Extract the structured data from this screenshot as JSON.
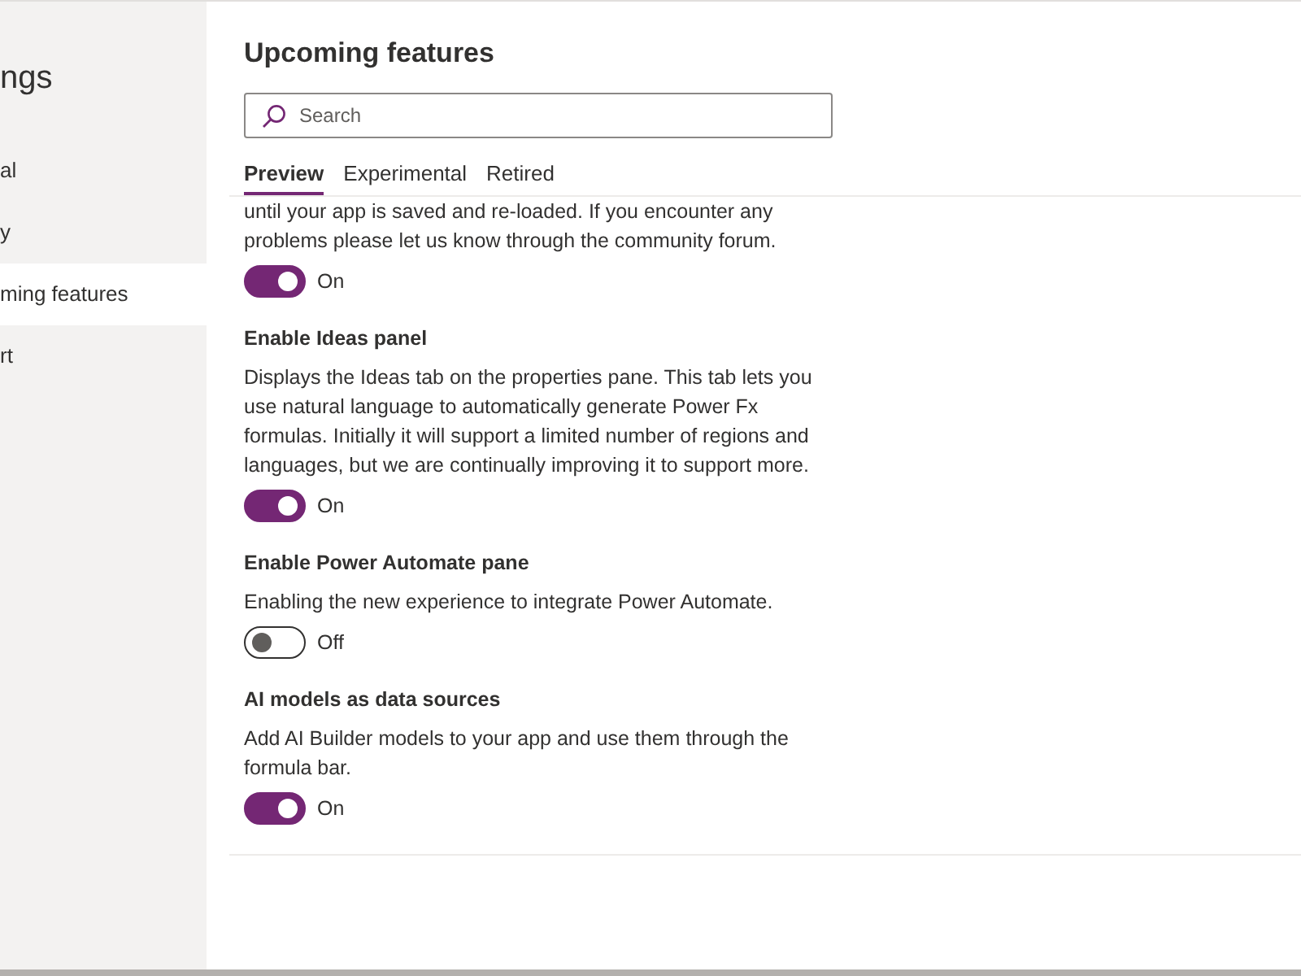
{
  "sidebar": {
    "title": "ngs",
    "items": [
      {
        "label": "al",
        "selected": false
      },
      {
        "label": "y",
        "selected": false
      },
      {
        "label": "ming features",
        "selected": true
      },
      {
        "label": "rt",
        "selected": false
      }
    ]
  },
  "page": {
    "title": "Upcoming features",
    "search": {
      "placeholder": "Search"
    },
    "tabs": [
      {
        "label": "Preview",
        "selected": true
      },
      {
        "label": "Experimental",
        "selected": false
      },
      {
        "label": "Retired",
        "selected": false
      }
    ],
    "features": [
      {
        "description": "until your app is saved and re-loaded. If you encounter any problems please let us know through the community forum.",
        "on": true,
        "state": "On"
      },
      {
        "title": "Enable Ideas panel",
        "description": "Displays the Ideas tab on the properties pane. This tab lets you use natural language to automatically generate Power Fx formulas. Initially it will support a limited number of regions and languages, but we are continually improving it to support more.",
        "on": true,
        "state": "On"
      },
      {
        "title": "Enable Power Automate pane",
        "description": "Enabling the new experience to integrate Power Automate.",
        "on": false,
        "state": "Off"
      },
      {
        "title": "AI models as data sources",
        "description": "Add AI Builder models to your app and use them through the formula bar.",
        "on": true,
        "state": "On"
      }
    ]
  }
}
